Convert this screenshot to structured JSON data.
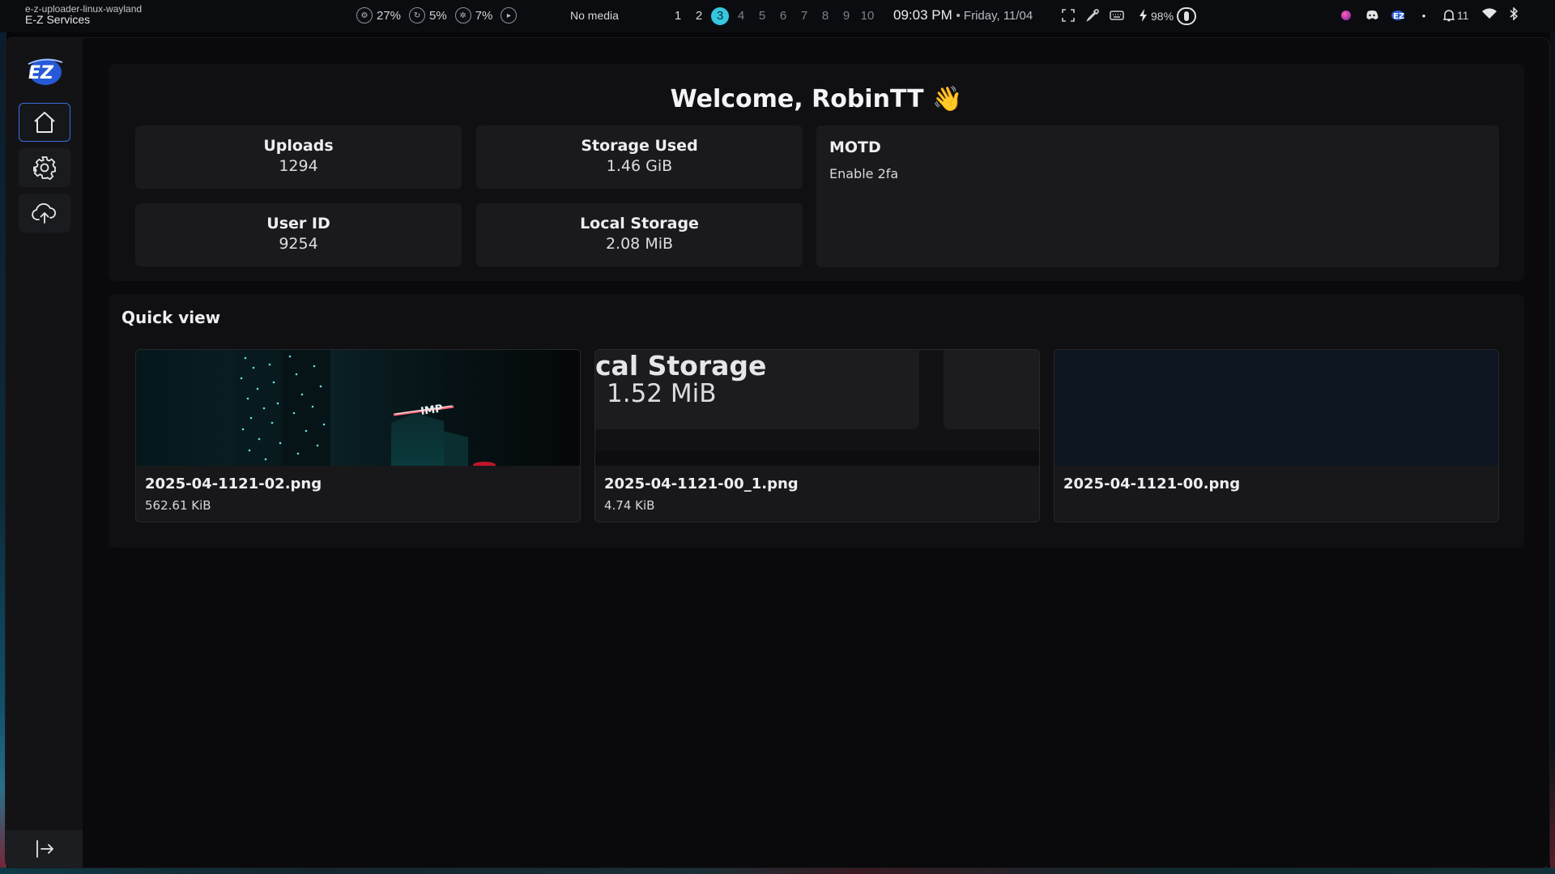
{
  "topbar": {
    "app_class": "e-z-uploader-linux-wayland",
    "app_title": "E-Z Services",
    "cpu": "27%",
    "memory": "5%",
    "temp": "7%",
    "media": "No media",
    "workspaces": [
      "1",
      "2",
      "3",
      "4",
      "5",
      "6",
      "7",
      "8",
      "9",
      "10"
    ],
    "active_workspace": "3",
    "time": "09:03 PM",
    "date": "• Friday, 11/04",
    "battery": "98%",
    "notifications": "11"
  },
  "window": {
    "welcome": "Welcome, RobinTT 👋",
    "stats": {
      "uploads_label": "Uploads",
      "uploads_value": "1294",
      "storage_label": "Storage Used",
      "storage_value": "1.46 GiB",
      "userid_label": "User ID",
      "userid_value": "9254",
      "local_label": "Local Storage",
      "local_value": "2.08 MiB"
    },
    "motd": {
      "label": "MOTD",
      "text": "Enable 2fa"
    },
    "quick_view": {
      "title": "Quick view",
      "files": [
        {
          "name": "2025-04-1121-02.png",
          "size": "562.61 KiB"
        },
        {
          "name": "2025-04-1121-00_1.png",
          "size": "4.74 KiB",
          "preview_title": "cal Storage",
          "preview_value": "1.52 MiB"
        },
        {
          "name": "2025-04-1121-00.png",
          "size": ""
        }
      ]
    }
  },
  "colors": {
    "accent": "#3b6ee0",
    "workspace_active": "#36c6df",
    "panel": "#101013",
    "card": "#1a1a1d"
  }
}
